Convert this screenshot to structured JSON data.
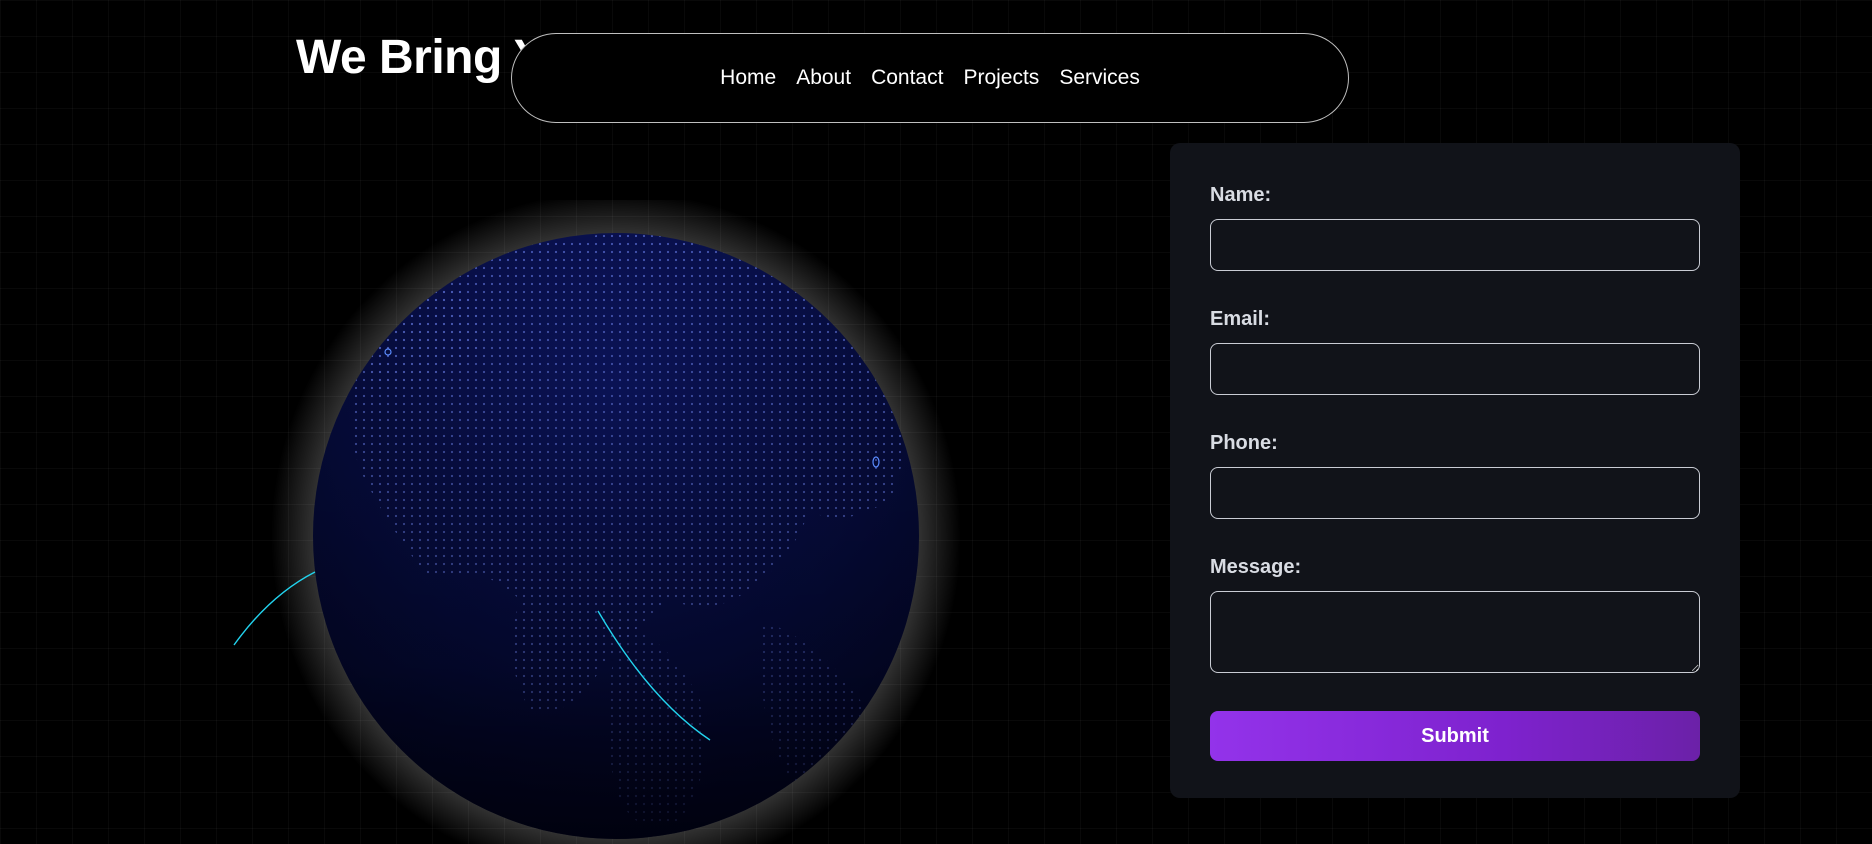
{
  "hero": {
    "title": "We Bring Y"
  },
  "nav": {
    "items": [
      {
        "label": "Home"
      },
      {
        "label": "About"
      },
      {
        "label": "Contact"
      },
      {
        "label": "Projects"
      },
      {
        "label": "Services"
      }
    ]
  },
  "form": {
    "name_label": "Name:",
    "name_value": "",
    "email_label": "Email:",
    "email_value": "",
    "phone_label": "Phone:",
    "phone_value": "",
    "message_label": "Message:",
    "message_value": "",
    "submit_label": "Submit"
  },
  "colors": {
    "background": "#000000",
    "card": "#111319",
    "accent_start": "#9333ea",
    "accent_end": "#6b21a8",
    "globe": "#0a1150",
    "arc": "#22d3ee"
  },
  "icons": {
    "globe": "globe-icon",
    "textarea_resize": "resize-handle-icon"
  }
}
